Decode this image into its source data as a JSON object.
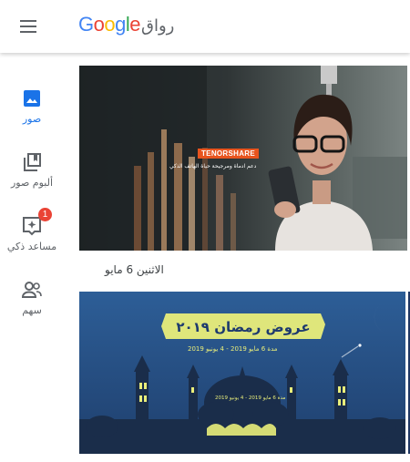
{
  "app": {
    "logo_text": "Google",
    "product_name": "رواق"
  },
  "nav": {
    "items": [
      {
        "label": "صور",
        "icon": "photo-icon",
        "active": true
      },
      {
        "label": "ألبوم صور",
        "icon": "album-icon",
        "active": false
      },
      {
        "label": "مساعد ذكي",
        "icon": "assistant-icon",
        "active": false,
        "badge": "1"
      },
      {
        "label": "سهم",
        "icon": "sharing-icon",
        "active": false
      }
    ]
  },
  "photos": [
    {
      "overlay_brand": "TENORSHARE",
      "overlay_tagline": "دعم ادماة ومرجيحة حياة الهاتف الذكي"
    },
    {
      "headline": "عروض رمضان ٢٠١٩",
      "subline": "مدة 6 مايو 2019 - 4 يونيو 2019",
      "small_text": "مدة 6 مايو 2019 - 4 يونيو 2019"
    }
  ],
  "date_group": {
    "label": "الاثنين 6 مايو"
  },
  "colors": {
    "accent": "#1a73e8",
    "badge": "#ea4335",
    "icon_gray": "#5f6368",
    "tenorshare_orange": "#e8541e"
  }
}
